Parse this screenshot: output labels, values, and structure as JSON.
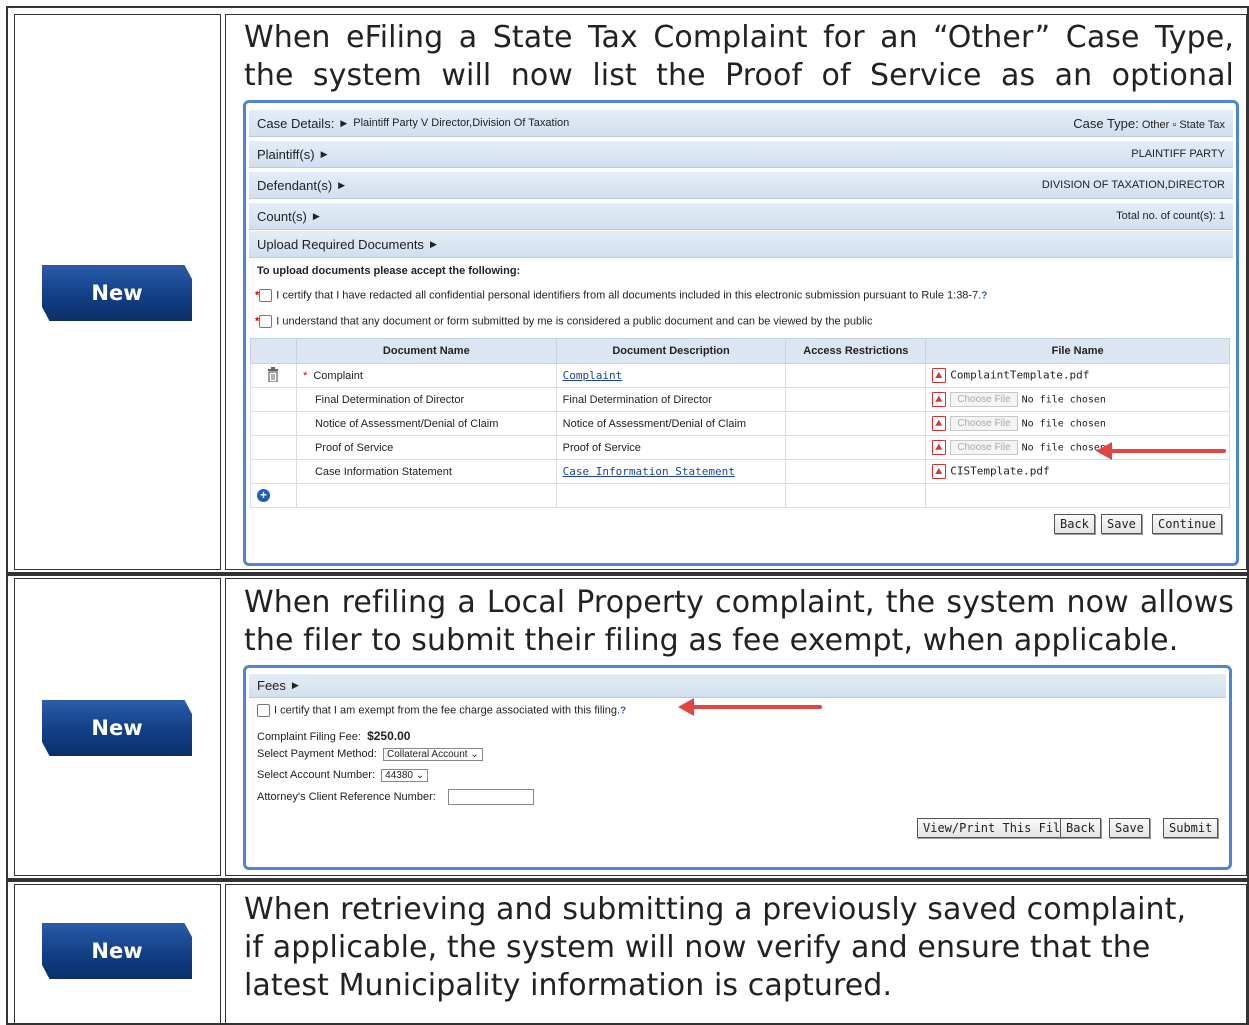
{
  "rows": [
    {
      "badge": "New",
      "description": "When eFiling a State Tax Complaint for an “Other” Case Type, the system will now list the Proof of Service as an optional attachment.",
      "shot": {
        "case_details_label": "Case Details:",
        "case_details_value": "Plaintiff Party V Director,Division Of Taxation",
        "case_type_label": "Case Type:",
        "case_type_value": "Other ▫ State Tax",
        "plaintiff_label": "Plaintiff(s)",
        "plaintiff_value": "PLAINTIFF PARTY",
        "defendant_label": "Defendant(s)",
        "defendant_value": "DIVISION OF TAXATION,DIRECTOR",
        "count_label": "Count(s)",
        "count_value": "Total no. of count(s): 1",
        "upload_label": "Upload Required Documents",
        "accept_text": "To upload documents please accept the following:",
        "cert1": "I certify that I have redacted all confidential personal identifiers from all documents included in this electronic submission pursuant to Rule 1:38-7.",
        "cert2": "I understand that any document or form submitted by me is considered a public document and can be viewed by the public",
        "columns": [
          "Document Name",
          "Document Description",
          "Access Restrictions",
          "File Name"
        ],
        "docs": [
          {
            "name": "Complaint",
            "desc": "Complaint",
            "file": "ComplaintTemplate.pdf"
          },
          {
            "name": "Final Determination of Director",
            "desc": "Final Determination of Director",
            "choose": "Choose File",
            "file": "No file chosen"
          },
          {
            "name": "Notice of Assessment/Denial of Claim",
            "desc": "Notice of Assessment/Denial of Claim",
            "choose": "Choose File",
            "file": "No file chosen"
          },
          {
            "name": "Proof of Service",
            "desc": "Proof of Service",
            "choose": "Choose File",
            "file": "No file chosen"
          },
          {
            "name": "Case Information Statement",
            "desc": "Case Information Statement",
            "file": "CISTemplate.pdf"
          }
        ],
        "buttons": {
          "back": "Back",
          "save": "Save",
          "continue": "Continue"
        }
      }
    },
    {
      "badge": "New",
      "description": "When refiling a Local Property complaint, the system now allows the filer to submit their filing as fee exempt, when applicable.",
      "shot": {
        "fees_label": "Fees",
        "exempt_text": "I certify that I am exempt from the fee charge associated with this filing.",
        "fee_label": "Complaint Filing Fee:",
        "fee_value": "$250.00",
        "payment_label": "Select Payment Method:",
        "payment_value": "Collateral Account",
        "account_label": "Select Account Number:",
        "account_value": "44380",
        "ref_label": "Attorney's Client Reference Number:",
        "buttons": {
          "view_print": "View/Print This Filing",
          "back": "Back",
          "save": "Save",
          "submit": "Submit"
        }
      }
    },
    {
      "badge": "New",
      "description": "When retrieving and submitting a previously saved complaint, if applicable, the system will now verify and ensure that the latest Municipality information is captured."
    }
  ],
  "icons": [
    "pdf-icon",
    "trash-icon",
    "add-circle-icon",
    "help-icon",
    "arrow-icon",
    "triangle-right-icon",
    "chevron-down-icon"
  ],
  "colors": {
    "badge": "#123f85",
    "arrow": "#e0463f",
    "bar": "#d8e4f1",
    "link": "#1a44a0"
  }
}
